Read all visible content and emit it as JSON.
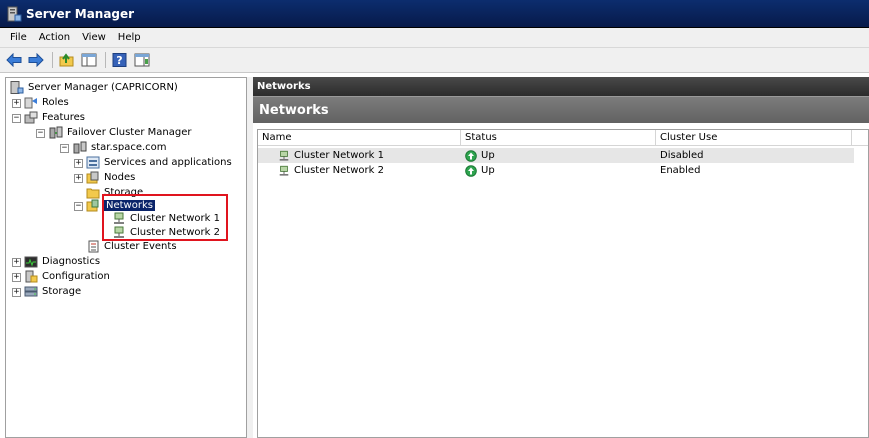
{
  "window": {
    "title": "Server Manager"
  },
  "menu": [
    "File",
    "Action",
    "View",
    "Help"
  ],
  "toolbar": {
    "icons": [
      "back-arrow-icon",
      "forward-arrow-icon",
      "up-folder-icon",
      "show-hide-tree-icon",
      "help-icon",
      "action-pane-icon"
    ]
  },
  "tree": {
    "root": "Server Manager (CAPRICORN)",
    "roles": "Roles",
    "features": "Features",
    "fcm": "Failover Cluster Manager",
    "cluster": "star.space.com",
    "services": "Services and applications",
    "nodes": "Nodes",
    "storage_cluster": "Storage",
    "networks": "Networks",
    "net1": "Cluster Network 1",
    "net2": "Cluster Network 2",
    "events": "Cluster Events",
    "diagnostics": "Diagnostics",
    "configuration": "Configuration",
    "storage": "Storage"
  },
  "right": {
    "header": "Networks",
    "section_title": "Networks",
    "columns": [
      "Name",
      "Status",
      "Cluster Use"
    ],
    "rows": [
      {
        "name": "Cluster Network 1",
        "status": "Up",
        "use": "Disabled"
      },
      {
        "name": "Cluster Network 2",
        "status": "Up",
        "use": "Enabled"
      }
    ]
  },
  "colors": {
    "title_bar": "#0c2d6e",
    "selection": "#0a246a",
    "highlight_box": "#e0141e",
    "status_up": "#2ea44f"
  }
}
